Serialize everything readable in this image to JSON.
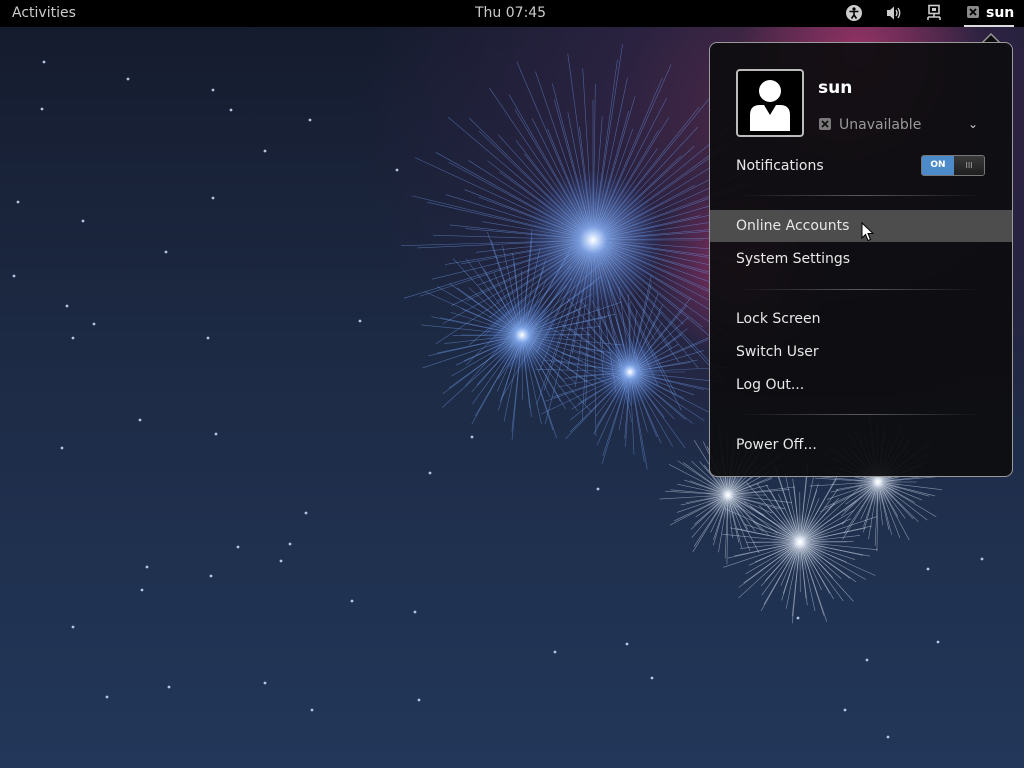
{
  "topbar": {
    "activities_label": "Activities",
    "clock": "Thu 07:45",
    "icons": [
      "accessibility-icon",
      "volume-icon",
      "network-icon",
      "user-status-unavailable-icon"
    ],
    "user_name": "sun"
  },
  "menu": {
    "user_name": "sun",
    "status_label": "Unavailable",
    "status_icon": "unavailable-icon",
    "notifications_label": "Notifications",
    "notifications_switch": {
      "state": "ON",
      "off_glyph": "III"
    },
    "items_group1": [
      "Online Accounts",
      "System Settings"
    ],
    "items_group2": [
      "Lock Screen",
      "Switch User",
      "Log Out..."
    ],
    "items_group3": [
      "Power Off..."
    ],
    "hovered_item": "Online Accounts"
  },
  "colors": {
    "topbar": "#000000",
    "menu_bg": "#0d0d0f",
    "hover": "#4d4d4d",
    "switch_on": "#4c8ac9"
  }
}
